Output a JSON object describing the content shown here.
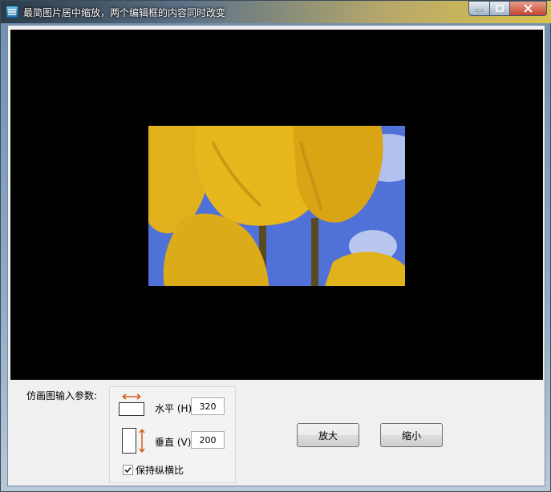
{
  "window": {
    "title": "最简图片居中缩放，两个编辑框的内容同时改变",
    "icon": "app-icon"
  },
  "controls": {
    "minimize_icon": "minimize-icon",
    "maximize_icon": "maximize-icon",
    "close_icon": "close-icon"
  },
  "image": {
    "subject": "yellow tulips against blue sky",
    "colors": {
      "petal": "#e3b21d",
      "sky": "#4f71d8",
      "background": "#000000"
    }
  },
  "params": {
    "label": "仿画图输入参数:",
    "horizontal_label": "水平 (H)",
    "horizontal_value": "320",
    "vertical_label": "垂直 (V)",
    "vertical_value": "200",
    "keep_ratio_label": "保持纵横比",
    "keep_ratio_checked": true,
    "horizontal_icon": "horizontal-resize-icon",
    "vertical_icon": "vertical-resize-icon"
  },
  "buttons": {
    "zoom_in": "放大",
    "zoom_out": "缩小"
  }
}
